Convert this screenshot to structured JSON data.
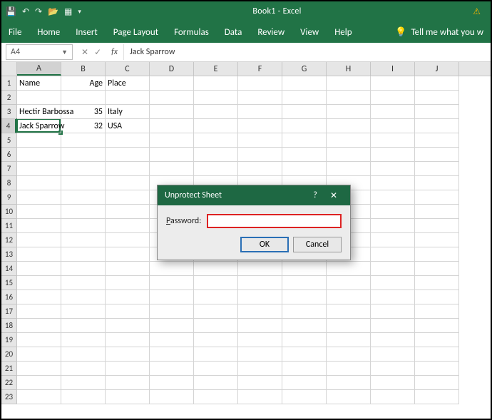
{
  "titlebar": {
    "title": "Book1 - Excel"
  },
  "ribbon": {
    "tabs": [
      "File",
      "Home",
      "Insert",
      "Page Layout",
      "Formulas",
      "Data",
      "Review",
      "View",
      "Help"
    ],
    "tellme": "Tell me what you w"
  },
  "fxbar": {
    "namebox": "A4",
    "formula": "Jack Sparrow"
  },
  "columns": [
    "A",
    "B",
    "C",
    "D",
    "E",
    "F",
    "G",
    "H",
    "I",
    "J"
  ],
  "selected": {
    "col": "A",
    "row": 4
  },
  "grid": {
    "rows": [
      {
        "n": 1,
        "cells": [
          "Name",
          "Age",
          "Place",
          "",
          "",
          "",
          "",
          "",
          "",
          ""
        ]
      },
      {
        "n": 2,
        "cells": [
          "",
          "",
          "",
          "",
          "",
          "",
          "",
          "",
          "",
          ""
        ]
      },
      {
        "n": 3,
        "cells": [
          "Hectir Barbossa",
          "35",
          "Italy",
          "",
          "",
          "",
          "",
          "",
          "",
          ""
        ]
      },
      {
        "n": 4,
        "cells": [
          "Jack Sparrow",
          "32",
          "USA",
          "",
          "",
          "",
          "",
          "",
          "",
          ""
        ]
      },
      {
        "n": 5,
        "cells": [
          "",
          "",
          "",
          "",
          "",
          "",
          "",
          "",
          "",
          ""
        ]
      },
      {
        "n": 6,
        "cells": [
          "",
          "",
          "",
          "",
          "",
          "",
          "",
          "",
          "",
          ""
        ]
      },
      {
        "n": 7,
        "cells": [
          "",
          "",
          "",
          "",
          "",
          "",
          "",
          "",
          "",
          ""
        ]
      },
      {
        "n": 8,
        "cells": [
          "",
          "",
          "",
          "",
          "",
          "",
          "",
          "",
          "",
          ""
        ]
      },
      {
        "n": 9,
        "cells": [
          "",
          "",
          "",
          "",
          "",
          "",
          "",
          "",
          "",
          ""
        ]
      },
      {
        "n": 10,
        "cells": [
          "",
          "",
          "",
          "",
          "",
          "",
          "",
          "",
          "",
          ""
        ]
      },
      {
        "n": 11,
        "cells": [
          "",
          "",
          "",
          "",
          "",
          "",
          "",
          "",
          "",
          ""
        ]
      },
      {
        "n": 12,
        "cells": [
          "",
          "",
          "",
          "",
          "",
          "",
          "",
          "",
          "",
          ""
        ]
      },
      {
        "n": 13,
        "cells": [
          "",
          "",
          "",
          "",
          "",
          "",
          "",
          "",
          "",
          ""
        ]
      },
      {
        "n": 14,
        "cells": [
          "",
          "",
          "",
          "",
          "",
          "",
          "",
          "",
          "",
          ""
        ]
      },
      {
        "n": 15,
        "cells": [
          "",
          "",
          "",
          "",
          "",
          "",
          "",
          "",
          "",
          ""
        ]
      },
      {
        "n": 16,
        "cells": [
          "",
          "",
          "",
          "",
          "",
          "",
          "",
          "",
          "",
          ""
        ]
      },
      {
        "n": 17,
        "cells": [
          "",
          "",
          "",
          "",
          "",
          "",
          "",
          "",
          "",
          ""
        ]
      },
      {
        "n": 18,
        "cells": [
          "",
          "",
          "",
          "",
          "",
          "",
          "",
          "",
          "",
          ""
        ]
      },
      {
        "n": 19,
        "cells": [
          "",
          "",
          "",
          "",
          "",
          "",
          "",
          "",
          "",
          ""
        ]
      },
      {
        "n": 20,
        "cells": [
          "",
          "",
          "",
          "",
          "",
          "",
          "",
          "",
          "",
          ""
        ]
      },
      {
        "n": 21,
        "cells": [
          "",
          "",
          "",
          "",
          "",
          "",
          "",
          "",
          "",
          ""
        ]
      },
      {
        "n": 22,
        "cells": [
          "",
          "",
          "",
          "",
          "",
          "",
          "",
          "",
          "",
          ""
        ]
      },
      {
        "n": 23,
        "cells": [
          "",
          "",
          "",
          "",
          "",
          "",
          "",
          "",
          "",
          ""
        ]
      }
    ]
  },
  "dialog": {
    "title": "Unprotect Sheet",
    "password_label": "Password:",
    "password_value": "",
    "ok": "OK",
    "cancel": "Cancel",
    "help": "?",
    "close": "✕"
  }
}
